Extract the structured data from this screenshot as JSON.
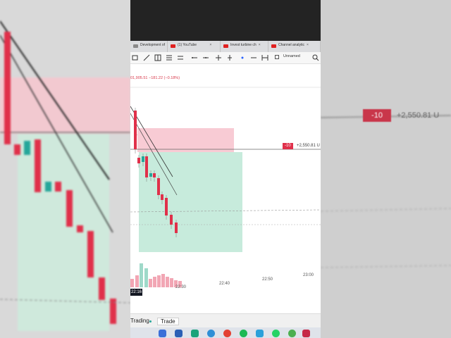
{
  "tabs": [
    {
      "label": "Development of",
      "icon": "page-icon"
    },
    {
      "label": "(1) YouTube",
      "icon": "youtube-icon"
    },
    {
      "label": "Invest turbine ch",
      "icon": "youtube-icon"
    },
    {
      "label": "Channel analytic",
      "icon": "youtube-icon"
    }
  ],
  "toolbar": {
    "layout_name": "Unnamed"
  },
  "price_line": "01,905.51  −181.22 (−0.18%)",
  "position": {
    "qty": "-10",
    "pl": "+2,550.81 U"
  },
  "position_zoom": {
    "qty": "-10",
    "pl": "+2,550.81 U"
  },
  "time_axis": {
    "cursor": "22:16",
    "ticks": [
      "22:30",
      "22:40",
      "22:50",
      "23:00"
    ]
  },
  "bottom_tabs": {
    "trading": "Trading",
    "trade": "Trade"
  },
  "colors": {
    "up": "#26a69a",
    "down": "#e0304a",
    "stop_zone": "#f7c5cf",
    "target_zone": "#bde8d6"
  },
  "chart_data": {
    "type": "candlestick",
    "candles": [
      {
        "dir": "down"
      },
      {
        "dir": "down"
      },
      {
        "dir": "up"
      },
      {
        "dir": "down"
      },
      {
        "dir": "up"
      },
      {
        "dir": "down"
      },
      {
        "dir": "down"
      },
      {
        "dir": "down"
      },
      {
        "dir": "down"
      },
      {
        "dir": "down"
      },
      {
        "dir": "down"
      }
    ],
    "volume_colors": [
      "down",
      "down",
      "up",
      "up",
      "down",
      "down",
      "down",
      "down",
      "down",
      "down",
      "down",
      "down"
    ]
  }
}
